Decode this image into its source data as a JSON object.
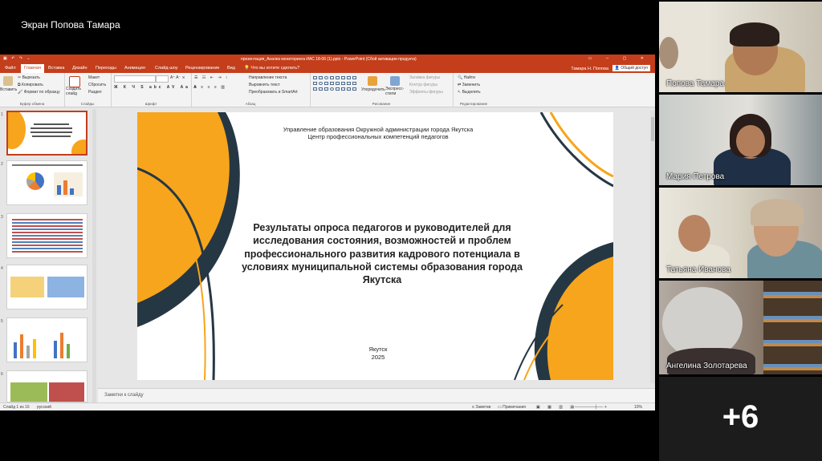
{
  "screen_share": {
    "label": "Экран Попова Тамара"
  },
  "powerpoint": {
    "window_title": "презентация_Анализ мониторинга ИАС 18-06 (1).pptx - PowerPoint (Сбой активации продукта)",
    "user": "Тамара Н. Попова",
    "share_label": "Общий доступ",
    "tabs": [
      "Файл",
      "Главная",
      "Вставка",
      "Дизайн",
      "Переходы",
      "Анимация",
      "Слайд-шоу",
      "Рецензирование",
      "Вид"
    ],
    "active_tab": "Главная",
    "tell_me": "Что вы хотите сделать?",
    "ribbon": {
      "clipboard": {
        "group": "Буфер обмена",
        "paste": "Вставить",
        "cut": "Вырезать",
        "copy": "Копировать",
        "format_painter": "Формат по образцу"
      },
      "slides": {
        "group": "Слайды",
        "new_slide": "Создать слайд",
        "layout": "Макет",
        "reset": "Сбросить",
        "section": "Раздел"
      },
      "font": {
        "group": "Шрифт"
      },
      "paragraph": {
        "group": "Абзац",
        "text_direction": "Направление текста",
        "align_text": "Выровнять текст",
        "smartart": "Преобразовать в SmartArt"
      },
      "drawing": {
        "group": "Рисование",
        "arrange": "Упорядочить",
        "quick_styles": "Экспресс-стили",
        "fill": "Заливка фигуры",
        "outline": "Контур фигуры",
        "effects": "Эффекты фигуры"
      },
      "editing": {
        "group": "Редактирование",
        "find": "Найти",
        "replace": "Заменить",
        "select": "Выделить"
      }
    },
    "thumbnails": [
      "1",
      "2",
      "3",
      "4",
      "5",
      "6"
    ],
    "slide": {
      "org_line1": "Управление образования Окружной администрации города Якутска",
      "org_line2": "Центр профессиональных компетенций педагогов",
      "title": "Результаты опроса педагогов и руководителей для исследования состояния, возможностей и проблем профессионального развития кадрового потенциала в условиях муниципальной системы образования города Якутска",
      "city": "Якутск",
      "year": "2025"
    },
    "notes_placeholder": "Заметки к слайду",
    "status": {
      "slide_info": "Слайд 1 из 16",
      "language": "русский",
      "notes": "Заметки",
      "comments": "Примечания",
      "zoom": "10%"
    }
  },
  "participants": [
    {
      "name": "Попова Тамара"
    },
    {
      "name": "Мария Петрова"
    },
    {
      "name": "Татьяна Иванова"
    },
    {
      "name": "Ангелина Золотарева"
    }
  ],
  "more_participants": "+6",
  "colors": {
    "ppt_accent": "#c43e1c",
    "orange": "#f7a51c",
    "navy": "#263744"
  }
}
